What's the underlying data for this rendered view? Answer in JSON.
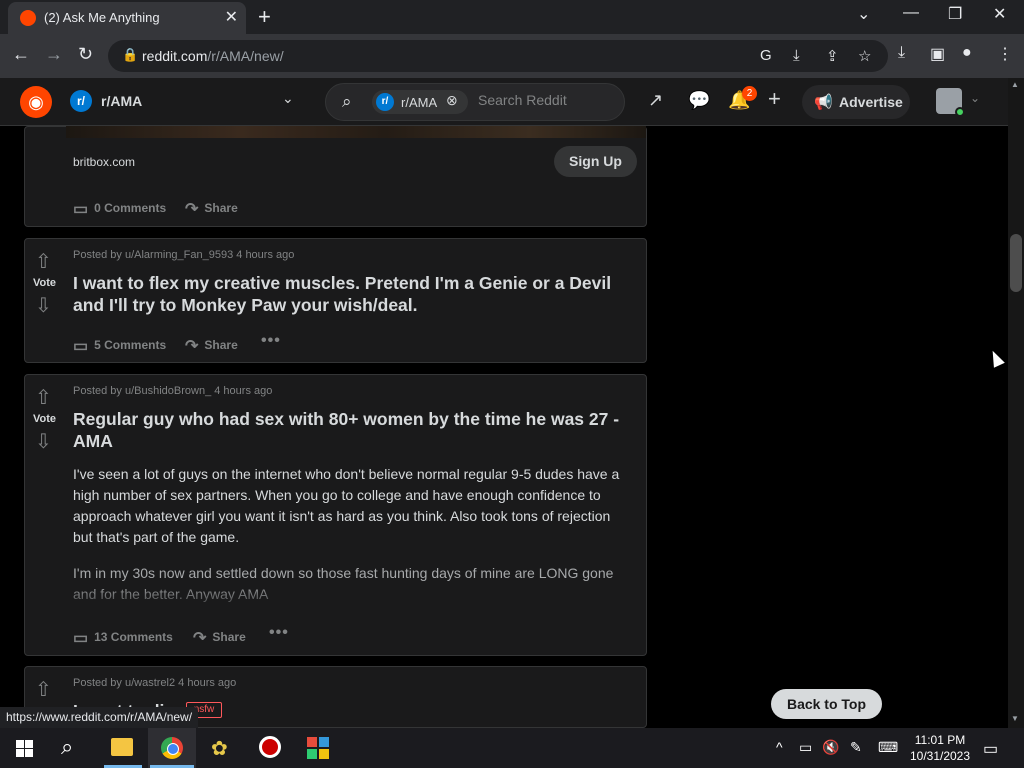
{
  "browser": {
    "tab_title": "(2) Ask Me Anything",
    "url_host": "reddit.com",
    "url_path": "/r/AMA/new/",
    "status_url": "https://www.reddit.com/r/AMA/new/"
  },
  "header": {
    "community": "r/AMA",
    "search_chip": "r/AMA",
    "search_placeholder": "Search Reddit",
    "notif_count": "2",
    "advertise_label": "Advertise"
  },
  "ad": {
    "domain": "britbox.com",
    "signup_label": "Sign Up",
    "comments": "0 Comments",
    "share": "Share"
  },
  "posts": [
    {
      "vote_label": "Vote",
      "meta": "Posted by u/Alarming_Fan_9593 4 hours ago",
      "title": "I want to flex my creative muscles. Pretend I'm a Genie or a Devil and I'll try to Monkey Paw your wish/deal.",
      "comments": "5 Comments",
      "share": "Share"
    },
    {
      "vote_label": "Vote",
      "meta": "Posted by u/BushidoBrown_ 4 hours ago",
      "title": "Regular guy who had sex with 80+ women by the time he was 27 - AMA",
      "body1": "I've seen a lot of guys on the internet who don't believe normal regular 9-5 dudes have a high number of sex partners. When you go to college and have enough confidence to approach whatever girl you want it isn't as hard as you think. Also took tons of rejection but that's part of the game.",
      "body2": "I'm in my 30s now and settled down so those fast hunting days of mine are LONG gone and for the better. Anyway AMA",
      "comments": "13 Comments",
      "share": "Share"
    },
    {
      "meta": "Posted by u/wastrel2 4 hours ago",
      "title_partial": "I want to die",
      "tag": "nsfw"
    }
  ],
  "back_to_top": "Back to Top",
  "taskbar": {
    "time": "11:01 PM",
    "date": "10/31/2023"
  },
  "colors": {
    "reddit_orange": "#ff4500",
    "community_blue": "#0079d3",
    "card_bg": "#1a1a1b",
    "text": "#d7dadc",
    "muted": "#818384"
  }
}
